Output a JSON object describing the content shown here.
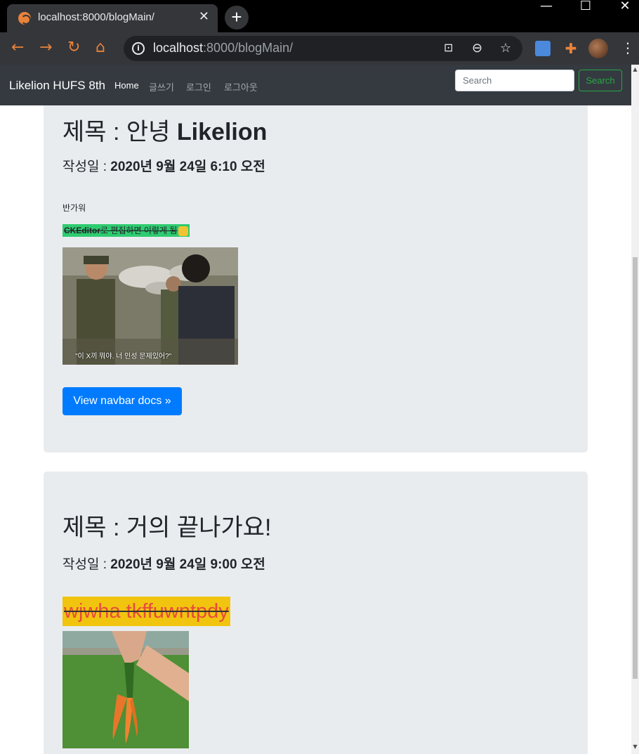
{
  "browser": {
    "tab_title": "localhost:8000/blogMain/",
    "tab_close": "✕",
    "new_tab": "+",
    "url_host": "localhost",
    "url_rest": ":8000/blogMain/",
    "controls": {
      "minimize": "—",
      "maximize": "☐",
      "close": "✕"
    }
  },
  "navbar": {
    "brand": "Likelion HUFS 8th",
    "links": [
      "Home",
      "글쓰기",
      "로그인",
      "로그아웃"
    ],
    "search_placeholder": "Search",
    "search_button": "Search"
  },
  "posts": [
    {
      "title_prefix": "제목 : 안녕 ",
      "title_bold": "Likelion",
      "date_prefix": "작성일 : ",
      "date_value": "2020년 9월 24일 6:10 오전",
      "body_text": "반가워",
      "highlight_bold": "CKEditor",
      "highlight_rest": "로 편집하면 이렇게 됨",
      "image_caption": "\"이 X끼 뭐야. 너 인성 문제있어?\"",
      "button": "View navbar docs »"
    },
    {
      "title": "제목 : 거의 끝나가요!",
      "date_prefix": "작성일 : ",
      "date_value": "2020년 9월 24일 9:00 오전",
      "strike_text": "wjwha tkffuwntpdy"
    }
  ],
  "colors": {
    "navbar_bg": "#343a40",
    "card_bg": "#e9ecef",
    "primary": "#007bff",
    "success": "#28a745",
    "highlight_green": "#2ecc71",
    "highlight_yellow": "#f1c40f",
    "strike_red": "#e74c3c"
  }
}
